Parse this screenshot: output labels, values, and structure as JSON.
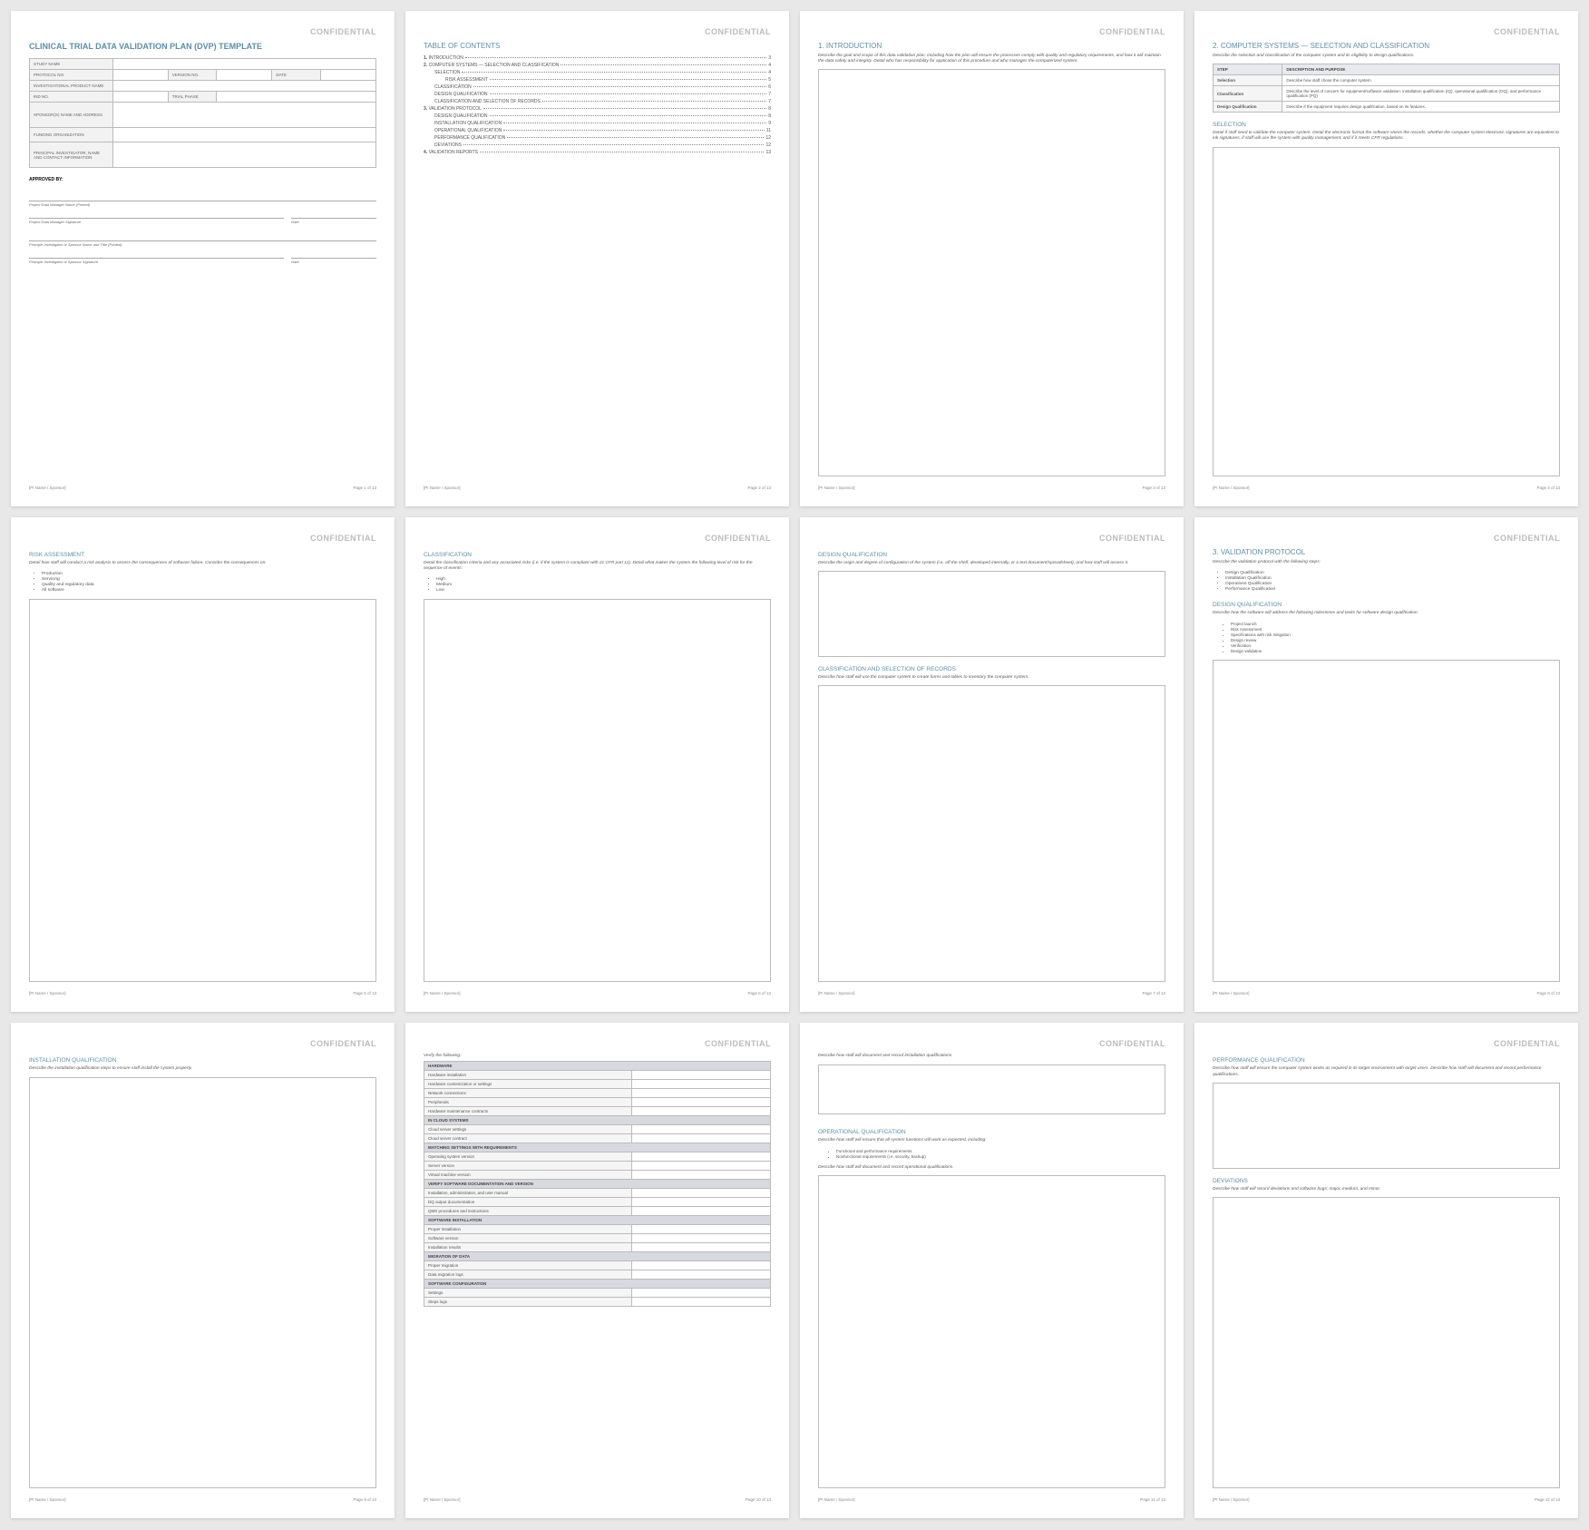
{
  "confidential": "CONFIDENTIAL",
  "footer_left": "[PI Name / Sponsor]",
  "footer_pages": [
    "Page 1 of 13",
    "Page 2 of 13",
    "Page 3 of 13",
    "Page 4 of 13",
    "Page 5 of 13",
    "Page 6 of 13",
    "Page 7 of 13",
    "Page 8 of 13",
    "Page 9 of 13",
    "Page 10 of 13",
    "Page 11 of 13",
    "Page 12 of 13"
  ],
  "p1": {
    "title": "CLINICAL TRIAL DATA VALIDATION PLAN (DVP) TEMPLATE",
    "fields": {
      "study": "STUDY NAME",
      "protocol": "PROTOCOL NO.",
      "version": "VERSION NO.",
      "date": "DATE",
      "product": "INVESTIGATIONAL PRODUCT NAME",
      "ind": "IND NO.",
      "phase": "TRIAL PHASE",
      "sponsor": "SPONSOR(S) NAME AND ADDRESS",
      "funding": "FUNDING ORGANIZATION",
      "pi": "PRINCIPAL INVESTIGATOR, NAME AND CONTACT INFORMATION"
    },
    "approved": "APPROVED BY:",
    "sigs": {
      "pdm_name": "Project Data Manager Name (Printed)",
      "pdm_sig": "Project Data Manager Signature",
      "date": "Date",
      "pi_name": "Principle Investigator or Sponsor Name and Title (Printed)",
      "pi_sig": "Principle Investigator or Sponsor Signature"
    }
  },
  "p2": {
    "title": "TABLE OF CONTENTS",
    "items": [
      {
        "n": "1.",
        "t": "INTRODUCTION",
        "p": "3",
        "i": 0
      },
      {
        "n": "2.",
        "t": "COMPUTER SYSTEMS — SELECTION AND CLASSIFICATION",
        "p": "4",
        "i": 0
      },
      {
        "n": "",
        "t": "SELECTION",
        "p": "4",
        "i": 1
      },
      {
        "n": "",
        "t": "RISK ASSESSMENT",
        "p": "5",
        "i": 2
      },
      {
        "n": "",
        "t": "CLASSIFICATION",
        "p": "6",
        "i": 1
      },
      {
        "n": "",
        "t": "DESIGN QUALIFICATION",
        "p": "7",
        "i": 1
      },
      {
        "n": "",
        "t": "CLASSIFICATION AND SELECTION OF RECORDS",
        "p": "7",
        "i": 1
      },
      {
        "n": "3.",
        "t": "VALIDATION PROTOCOL",
        "p": "8",
        "i": 0
      },
      {
        "n": "",
        "t": "DESIGN QUALIFICATION",
        "p": "8",
        "i": 1
      },
      {
        "n": "",
        "t": "INSTALLATION QUALIFICATION",
        "p": "9",
        "i": 1
      },
      {
        "n": "",
        "t": "OPERATIONAL QUALIFICATION",
        "p": "11",
        "i": 1
      },
      {
        "n": "",
        "t": "PERFORMANCE QUALIFICATION",
        "p": "12",
        "i": 1
      },
      {
        "n": "",
        "t": "DEVIATIONS",
        "p": "12",
        "i": 1
      },
      {
        "n": "4.",
        "t": "VALIDATION REPORTS",
        "p": "13",
        "i": 0
      }
    ]
  },
  "p3": {
    "title": "1. INTRODUCTION",
    "desc": "Describe the goal and scope of this data validation plan, including how the plan will ensure the processes comply with quality and regulatory requirements, and how it will maintain the data safety and integrity. Detail who has responsibility for application of this procedure and who manages the computerized system."
  },
  "p4": {
    "title": "2. COMPUTER SYSTEMS — SELECTION AND CLASSIFICATION",
    "desc": "Describe the selection and classification of the computer system and its eligibility to design qualifications.",
    "th1": "STEP",
    "th2": "DESCRIPTION AND PURPOSE",
    "rows": [
      {
        "k": "Selection",
        "v": "Describe how staff chose the computer system."
      },
      {
        "k": "Classification",
        "v": "Describe the level of concern for equipment/software validation: installation qualification (IQ), operational qualification (OQ), and performance qualification (PQ)"
      },
      {
        "k": "Design Qualification",
        "v": "Describe if the equipment requires design qualification, based on its features."
      }
    ],
    "sel_title": "SELECTION",
    "sel_desc": "Detail if staff need to validate the computer system. Detail the electronic format the software stores the records, whether the computer system electronic signatures are equivalent to ink signatures, if staff will use the system with quality management, and if it meets CFR regulations."
  },
  "p5": {
    "title": "RISK ASSESSMENT",
    "desc": "Detail how staff will conduct a risk analysis to assess the consequences of software failure. Consider the consequences on:",
    "bullets": [
      "Production",
      "Servicing",
      "Quality and regulatory data",
      "All software"
    ]
  },
  "p6": {
    "title": "CLASSIFICATION",
    "desc": "Detail the classification criteria and any associated risks (i.e. if the system is compliant with 21 CFR part 11). Detail what makes the system the following level of risk for the sequence of events:",
    "bullets": [
      "High",
      "Medium",
      "Low"
    ]
  },
  "p7": {
    "t1": "DESIGN QUALIFICATION",
    "d1": "Describe the origin and degree of configuration of the system (i.e. off the shelf, developed internally, or a text document/spreadsheet), and how staff will assess it.",
    "t2": "CLASSIFICATION AND SELECTION OF RECORDS",
    "d2": "Describe how staff will use the computer system to create forms and tables to inventory the computer system."
  },
  "p8": {
    "title": "3. VALIDATION PROTOCOL",
    "desc": "Describe the validation protocol with the following steps:",
    "steps": [
      "Design Qualification",
      "Installation Qualification",
      "Operations Qualification",
      "Performance Qualification"
    ],
    "dq_title": "DESIGN QUALIFICATION",
    "dq_desc": "Describe how the software will address the following milestones and tasks for software design qualification:",
    "dq_items": [
      "Project launch",
      "Risk Assessment",
      "Specifications with risk mitigation",
      "Design review",
      "Verification",
      "Design validation"
    ]
  },
  "p9": {
    "title": "INSTALLATION QUALIFICATION",
    "desc": "Describe the installation qualification steps to ensure staff install the system properly."
  },
  "p10": {
    "intro": "Verify the following:",
    "groups": [
      {
        "h": "HARDWARE",
        "items": [
          "Hardware installation",
          "Hardware customization or settings",
          "Network connections",
          "Peripherals",
          "Hardware maintenance contracts"
        ]
      },
      {
        "h": "IN CLOUD SYSTEMS",
        "items": [
          "Cloud server settings",
          "Cloud server contract"
        ]
      },
      {
        "h": "MATCHING SETTINGS WITH REQUIREMENTS",
        "items": [
          "Operating system version",
          "Server version",
          "Virtual machine version"
        ]
      },
      {
        "h": "VERIFY SOFTWARE DOCUMENTATION AND VERSION",
        "items": [
          "Installation, administration, and user manual",
          "DQ output documentation",
          "QMS procedures and instructions"
        ]
      },
      {
        "h": "SOFTWARE INSTALLATION",
        "items": [
          "Proper installation",
          "Software version",
          "Installation results"
        ]
      },
      {
        "h": "MIGRATION OF DATA",
        "items": [
          "Proper migration",
          "Data migration logs"
        ]
      },
      {
        "h": "SOFTWARE CONFIGURATION",
        "items": [
          "Settings",
          "Steps logs"
        ]
      }
    ]
  },
  "p11": {
    "d1": "Describe how staff will document and record installation qualifications.",
    "t2": "OPERATIONAL QUALIFICATION",
    "d2": "Describe how staff will ensure that all system functions will work as expected, including:",
    "bullets": [
      "Functional and performance requirements",
      "Nonfunctional requirements (i.e. security, backup)"
    ],
    "d3": "Describe how staff will document and record operational qualifications."
  },
  "p12": {
    "t1": "PERFORMANCE QUALIFICATION",
    "d1": "Describe how staff will ensure the computer system works as required in its target environment with target users. Describe how staff will document and record performance qualifications.",
    "t2": "DEVIATIONS",
    "d2": "Describe how staff will record deviations and software bugs; major, medium, and minor."
  }
}
